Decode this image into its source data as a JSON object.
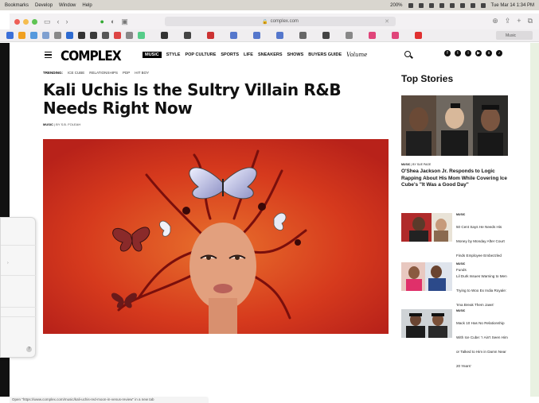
{
  "menubar": {
    "items": [
      "Bookmarks",
      "Develop",
      "Window",
      "Help"
    ],
    "zoom": "200%",
    "clock": "Tue Mar 14  1:34 PM"
  },
  "toolbar": {
    "address": "complex.com",
    "back": "‹",
    "forward": "›"
  },
  "bookmarks": {
    "colors": [
      "#3b6fd8",
      "#f0a020",
      "#5599dd",
      "#7fa0d0",
      "#888",
      "#2d6ad0",
      "#333",
      "#3a3a3a",
      "#555",
      "#d44",
      "#888",
      "#5c8",
      "#333",
      "#444",
      "#c33",
      "#5577cc",
      "#5577cc",
      "#5577cc",
      "#666",
      "#444",
      "#888",
      "#e0457a",
      "#e0457a",
      "#e03030",
      "#cc3355"
    ],
    "tab_label": "Music"
  },
  "site": {
    "logo": "COMPLEX",
    "nav": [
      {
        "label": "MUSIC",
        "active": true
      },
      {
        "label": "STYLE"
      },
      {
        "label": "POP CULTURE"
      },
      {
        "label": "SPORTS"
      },
      {
        "label": "LIFE"
      },
      {
        "label": "SNEAKERS"
      },
      {
        "label": "SHOWS"
      },
      {
        "label": "BUYERS GUIDE"
      }
    ],
    "nav_script": "Volume"
  },
  "trending": {
    "label": "TRENDING:",
    "items": [
      "ICE CUBE",
      "RELATIONSHIPS",
      "PDP",
      "HIT BOY"
    ]
  },
  "article": {
    "headline": "Kali Uchis Is the Sultry Villain R&B Needs Right Now",
    "byline_section": "MUSIC",
    "byline_author": " | BY S.B. FOLEAH"
  },
  "top_stories": {
    "title": "Top Stories",
    "main": {
      "tag": "MUSIC",
      "tag_suffix": " | BY SUE PAGE",
      "title": "O'Shea Jackson Jr. Responds to Logic Rapping About His Mom While Covering Ice Cube's \"It Was a Good Day\""
    },
    "items": [
      {
        "tag": "MUSIC",
        "title": "50 Cent Says He Needs His Money by Monday After Court Finds Employee Embezzled Funds"
      },
      {
        "tag": "MUSIC",
        "title": "Lil Durk Issues Warning to Men Trying to Woo Ex India Royale: 'Ima Break Them Jaws'"
      },
      {
        "tag": "MUSIC",
        "title": "Mack 10 Has No Relationship With Ice Cube: 'I Ain't Seen Him or Talked to Him in Damn Near 20 Years'"
      }
    ]
  },
  "statusbar": {
    "text": "Open \"https://www.complex.com/music/kali-uchis-red-moon-in-venus-review\" in a new tab"
  },
  "colors": {
    "hero_bg": "#d63a1d",
    "accent": "#000000"
  }
}
